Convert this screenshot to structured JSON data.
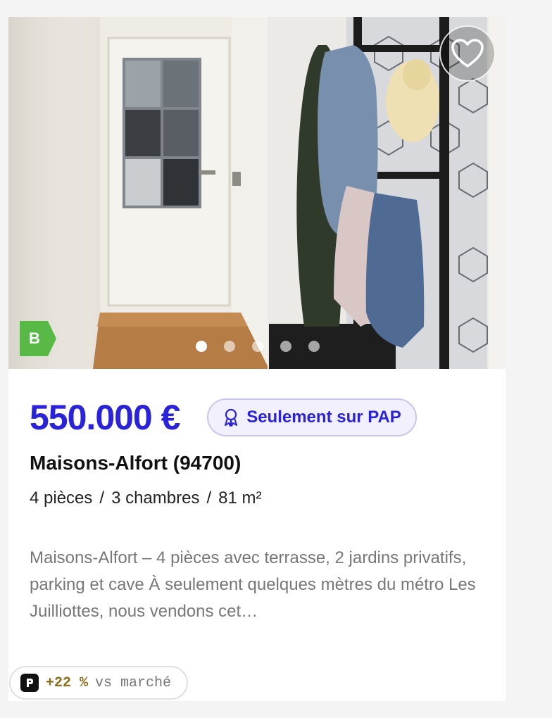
{
  "listing": {
    "energy_class": "B",
    "price": "550.000 €",
    "badge_label": "Seulement sur PAP",
    "city": "Maisons-Alfort (94700)",
    "specs": {
      "rooms": "4 pièces",
      "bedrooms": "3 chambres",
      "area": "81 m²",
      "separator": "/"
    },
    "description": "Maisons-Alfort – 4 pièces avec terrasse, 2 jardins privatifs, parking et cave À seulement quelques mètres du métro Les Juilliottes, nous vendons cet…",
    "market_compare": {
      "value": "+22 %",
      "label": "vs marché"
    },
    "carousel": {
      "count": 5,
      "active_index": 0
    }
  },
  "icons": {
    "favorite": "heart-outline-icon",
    "badge": "award-ribbon-icon",
    "market_logo": "p-logo-icon"
  },
  "colors": {
    "accent": "#2a23d9",
    "energy_b": "#58b947",
    "badge_bg": "#f1f0fc",
    "market_pct": "#8a6d1a"
  }
}
